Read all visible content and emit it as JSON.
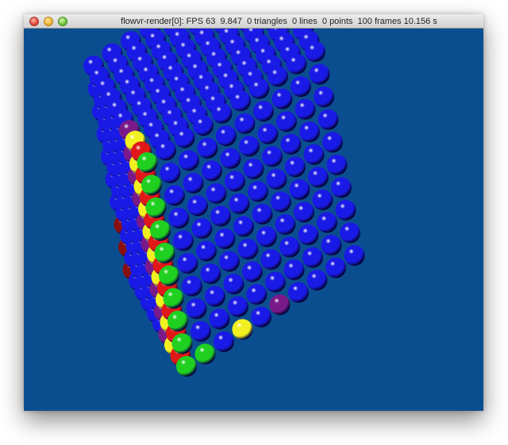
{
  "window": {
    "title": "flowvr-render[0]: FPS 63  9.847  0 triangles  0 lines  0 points  100 frames 10.156 s",
    "controls": {
      "close": "close-button",
      "minimize": "minimize-button",
      "zoom": "zoom-button"
    }
  },
  "scene": {
    "background_color": "#0b4e8f",
    "grid_size": 10,
    "sphere_colors": {
      "blue": "#1a1ae6",
      "red": "#e01818",
      "yellow": "#f2f020",
      "green": "#20d020",
      "purple": "#7a1a8a",
      "darkred": "#8a1010"
    }
  }
}
